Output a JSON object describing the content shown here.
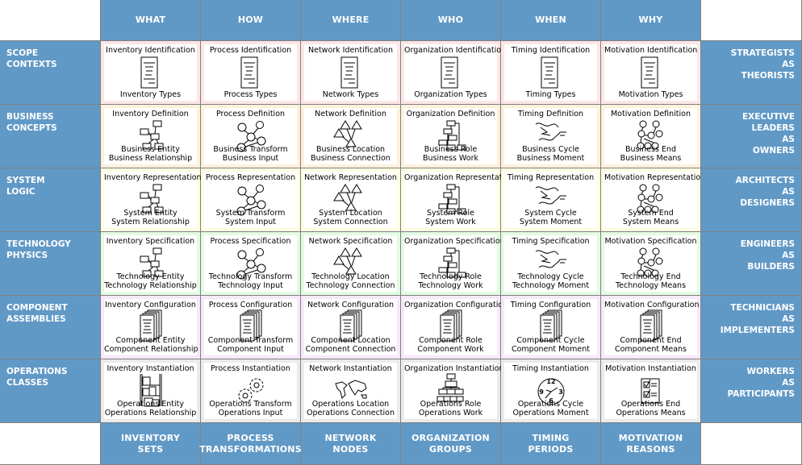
{
  "columns": [
    {
      "header": "WHAT",
      "footer_line1": "INVENTORY",
      "footer_line2": "SETS"
    },
    {
      "header": "HOW",
      "footer_line1": "PROCESS",
      "footer_line2": "TRANSFORMATIONS"
    },
    {
      "header": "WHERE",
      "footer_line1": "NETWORK",
      "footer_line2": "NODES"
    },
    {
      "header": "WHO",
      "footer_line1": "ORGANIZATION",
      "footer_line2": "GROUPS"
    },
    {
      "header": "WHEN",
      "footer_line1": "TIMING",
      "footer_line2": "PERIODS"
    },
    {
      "header": "WHY",
      "footer_line1": "MOTIVATION",
      "footer_line2": "REASONS"
    }
  ],
  "rows": [
    {
      "label_line1": "SCOPE",
      "label_line2": "CONTEXTS",
      "role": [
        "STRATEGISTS",
        "AS",
        "THEORISTS"
      ],
      "cells": [
        {
          "title": "Inventory Identification",
          "line1": "Inventory Types",
          "line2": "",
          "icon": "document-icon"
        },
        {
          "title": "Process Identification",
          "line1": "Process Types",
          "line2": "",
          "icon": "document-icon"
        },
        {
          "title": "Network Identification",
          "line1": "Network Types",
          "line2": "",
          "icon": "document-icon"
        },
        {
          "title": "Organization Identification",
          "line1": "Organization Types",
          "line2": "",
          "icon": "document-icon"
        },
        {
          "title": "Timing Identification",
          "line1": "Timing Types",
          "line2": "",
          "icon": "document-icon"
        },
        {
          "title": "Motivation Identification",
          "line1": "Motivation Types",
          "line2": "",
          "icon": "document-icon"
        }
      ]
    },
    {
      "label_line1": "BUSINESS",
      "label_line2": "CONCEPTS",
      "role": [
        "EXECUTIVE",
        "LEADERS",
        "AS",
        "OWNERS"
      ],
      "cells": [
        {
          "title": "Inventory Definition",
          "line1": "Business Entity",
          "line2": "Business Relationship",
          "icon": "entity-diagram-icon"
        },
        {
          "title": "Process Definition",
          "line1": "Business Transform",
          "line2": "Business Input",
          "icon": "process-diagram-icon"
        },
        {
          "title": "Network Definition",
          "line1": "Business Location",
          "line2": "Business Connection",
          "icon": "network-diagram-icon"
        },
        {
          "title": "Organization Definition",
          "line1": "Business Role",
          "line2": "Business Work",
          "icon": "org-chart-icon"
        },
        {
          "title": "Timing Definition",
          "line1": "Business Cycle",
          "line2": "Business Moment",
          "icon": "timing-diagram-icon"
        },
        {
          "title": "Motivation Definition",
          "line1": "Business End",
          "line2": "Business Means",
          "icon": "motivation-diagram-icon"
        }
      ]
    },
    {
      "label_line1": "SYSTEM",
      "label_line2": "LOGIC",
      "role": [
        "ARCHITECTS",
        "AS",
        "DESIGNERS"
      ],
      "cells": [
        {
          "title": "Inventory Representation",
          "line1": "System Entity",
          "line2": "System Relationship",
          "icon": "entity-diagram-icon"
        },
        {
          "title": "Process Representation",
          "line1": "System Transform",
          "line2": "System Input",
          "icon": "process-diagram-icon"
        },
        {
          "title": "Network Representation",
          "line1": "System Location",
          "line2": "System Connection",
          "icon": "network-diagram-icon"
        },
        {
          "title": "Organization Representation",
          "line1": "System Role",
          "line2": "System Work",
          "icon": "org-chart-icon"
        },
        {
          "title": "Timing Representation",
          "line1": "System Cycle",
          "line2": "System Moment",
          "icon": "timing-diagram-icon"
        },
        {
          "title": "Motivation Representation",
          "line1": "System End",
          "line2": "System Means",
          "icon": "motivation-diagram-icon"
        }
      ]
    },
    {
      "label_line1": "TECHNOLOGY",
      "label_line2": "PHYSICS",
      "role": [
        "ENGINEERS",
        "AS",
        "BUILDERS"
      ],
      "cells": [
        {
          "title": "Inventory Specification",
          "line1": "Technology Entity",
          "line2": "Technology Relationship",
          "icon": "entity-diagram-icon"
        },
        {
          "title": "Process Specification",
          "line1": "Technology Transform",
          "line2": "Technology Input",
          "icon": "process-diagram-icon"
        },
        {
          "title": "Network Specification",
          "line1": "Technology Location",
          "line2": "Technology Connection",
          "icon": "network-diagram-icon"
        },
        {
          "title": "Organization Specification",
          "line1": "Technology Role",
          "line2": "Technology Work",
          "icon": "org-chart-icon"
        },
        {
          "title": "Timing Specification",
          "line1": "Technology Cycle",
          "line2": "Technology Moment",
          "icon": "timing-diagram-icon"
        },
        {
          "title": "Motivation Specification",
          "line1": "Technology End",
          "line2": "Technology Means",
          "icon": "motivation-diagram-icon"
        }
      ]
    },
    {
      "label_line1": "COMPONENT",
      "label_line2": "ASSEMBLIES",
      "role": [
        "TECHNICIANS",
        "AS",
        "IMPLEMENTERS"
      ],
      "cells": [
        {
          "title": "Inventory Configuration",
          "line1": "Component Entity",
          "line2": "Component Relationship",
          "icon": "document-stack-icon"
        },
        {
          "title": "Process Configuration",
          "line1": "Component Transform",
          "line2": "Component Input",
          "icon": "document-stack-icon"
        },
        {
          "title": "Network Configuration",
          "line1": "Component Location",
          "line2": "Component Connection",
          "icon": "document-stack-icon"
        },
        {
          "title": "Organization Configuration",
          "line1": "Component Role",
          "line2": "Component Work",
          "icon": "document-stack-icon"
        },
        {
          "title": "Timing Configuration",
          "line1": "Component Cycle",
          "line2": "Component Moment",
          "icon": "document-stack-icon"
        },
        {
          "title": "Motivation Configuration",
          "line1": "Component End",
          "line2": "Component Means",
          "icon": "document-stack-icon"
        }
      ]
    },
    {
      "label_line1": "OPERATIONS",
      "label_line2": "CLASSES",
      "role": [
        "WORKERS",
        "AS",
        "PARTICIPANTS"
      ],
      "cells": [
        {
          "title": "Inventory Instantiation",
          "line1": "Operations Entity",
          "line2": "Operations Relationship",
          "icon": "shelves-icon"
        },
        {
          "title": "Process Instantiation",
          "line1": "Operations Transform",
          "line2": "Operations Input",
          "icon": "gears-icon"
        },
        {
          "title": "Network Instantiation",
          "line1": "Operations Location",
          "line2": "Operations Connection",
          "icon": "world-map-icon"
        },
        {
          "title": "Organization Instantiation",
          "line1": "Operations Role",
          "line2": "Operations Work",
          "icon": "hierarchy-icon"
        },
        {
          "title": "Timing Instantiation",
          "line1": "Operations Cycle",
          "line2": "Operations Moment",
          "icon": "clock-icon",
          "clock_numbers": [
            "12",
            "3",
            "6",
            "9"
          ]
        },
        {
          "title": "Motivation Instantiation",
          "line1": "Operations End",
          "line2": "Operations Means",
          "icon": "checklist-icon"
        }
      ]
    }
  ],
  "colors": {
    "header_bg": "#6199c6",
    "grid_line": "#808080",
    "row_tints": [
      "#fde6e6",
      "#fdf0dc",
      "#fdfde3",
      "#e3fbe3",
      "#f7e8fb",
      "#ebebeb"
    ]
  }
}
